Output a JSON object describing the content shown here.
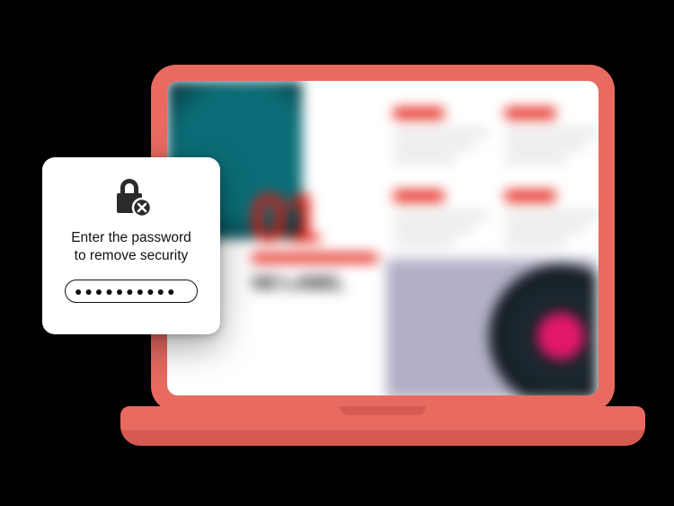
{
  "laptop": {
    "frame_color": "#e86a61"
  },
  "content": {
    "headline_number": "01",
    "subtitle": "ND LABEL",
    "accent_color": "#e3180d"
  },
  "dialog": {
    "message_line1": "Enter the password",
    "message_line2": "to remove security",
    "password_mask": "●●●●●●●●●●"
  }
}
